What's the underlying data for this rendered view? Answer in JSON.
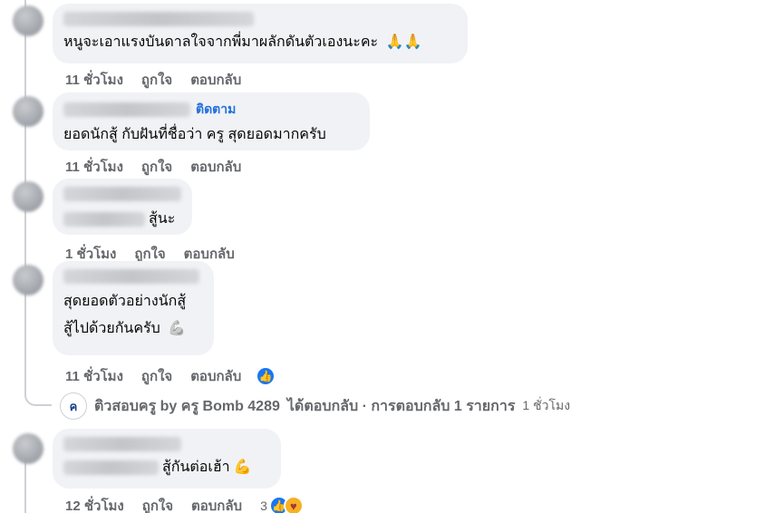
{
  "comments": [
    {
      "text": "หนูจะเอาแรงบันดาลใจจากพี่มาผลักดันตัวเองนะคะ",
      "emoji": "🙏🙏",
      "time": "11 ชั่วโมง",
      "like": "ถูกใจ",
      "reply": "ตอบกลับ"
    },
    {
      "follow": "ติดตาม",
      "text": "ยอดนักสู้ กับฝันที่ชื่อว่า ครู สุดยอดมากครับ",
      "time": "11 ชั่วโมง",
      "like": "ถูกใจ",
      "reply": "ตอบกลับ"
    },
    {
      "text": "สู้นะ",
      "time": "1 ชั่วโมง",
      "like": "ถูกใจ",
      "reply": "ตอบกลับ"
    },
    {
      "text_line1": "สุดยอดตัวอย่างนักสู้",
      "text_line2": "สู้ไปด้วยกันครับ",
      "emoji": "💪",
      "time": "11 ชั่วโมง",
      "like": "ถูกใจ",
      "reply": "ตอบกลับ"
    },
    {
      "text": "สู้กันต่อเฮ้า",
      "emoji": "💪",
      "time": "12 ชั่วโมง",
      "like": "ถูกใจ",
      "reply": "ตอบกลับ",
      "reaction_count": "3"
    }
  ],
  "reply_summary": {
    "page_name": "ติวสอบครู by ครู Bomb 4289",
    "text": "ได้ตอบกลับ · การตอบกลับ 1 รายการ",
    "time": "1 ชั่วโมง"
  },
  "colors": {
    "bubble": "#f0f2f5",
    "action_text": "#65676b",
    "follow_link": "#216fdb",
    "like_blue": "#1877f2"
  },
  "icons": [
    "like-reaction-icon",
    "care-reaction-icon",
    "page-avatar-icon"
  ]
}
